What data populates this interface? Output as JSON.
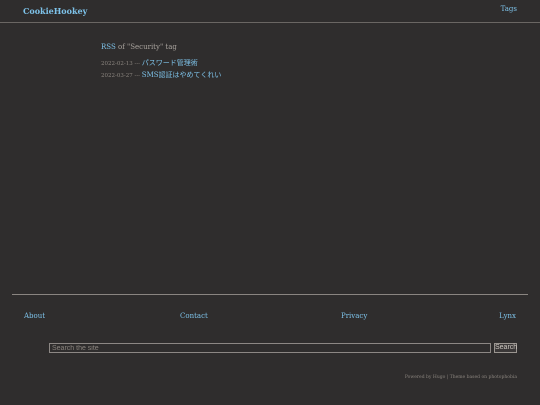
{
  "header": {
    "brand": "CookieHookey",
    "tags_link": "Tags"
  },
  "main": {
    "rss_label": "RSS",
    "rss_suffix": " of \"Security\" tag",
    "posts": [
      {
        "date": "2022-02-13",
        "sep": " --- ",
        "title": "パスワード管理術"
      },
      {
        "date": "2022-03-27",
        "sep": " --- ",
        "title": "SMS認証はやめてくれい"
      }
    ]
  },
  "footer": {
    "links": [
      "About",
      "Contact",
      "Privacy",
      "Lynx"
    ],
    "search_placeholder": "Search the site",
    "search_button": "Search",
    "powered_prefix": "Powered by ",
    "powered_hugo": "Hugo",
    "powered_middle": " | Theme based on ",
    "powered_theme": "photophobia"
  }
}
